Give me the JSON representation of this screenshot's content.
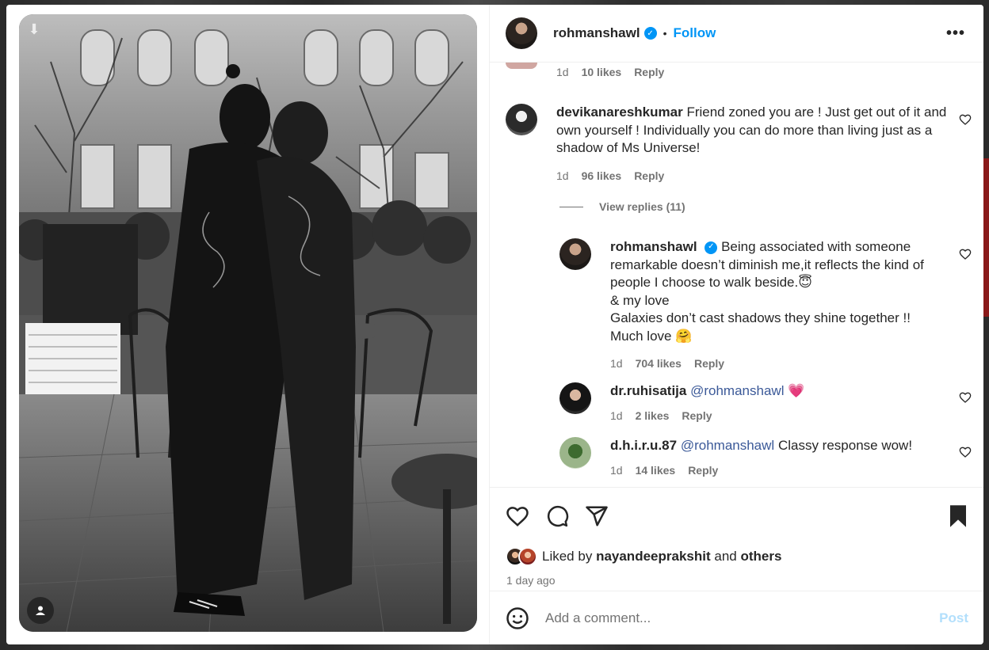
{
  "header": {
    "username": "rohmanshawl",
    "dot": "•",
    "follow_label": "Follow",
    "more_label": "•••"
  },
  "partial_comment": {
    "time": "1d",
    "likes": "10 likes",
    "reply": "Reply"
  },
  "comments": [
    {
      "username": "devikanareshkumar",
      "text": "Friend zoned you are ! Just get out of it and own yourself ! Individually you can do more than living just as a shadow of Ms Universe!",
      "time": "1d",
      "likes": "96 likes",
      "reply": "Reply"
    }
  ],
  "view_replies": "View replies (11)",
  "replies": [
    {
      "username": "rohmanshawl",
      "verified": true,
      "line1": "Being associated with someone remarkable doesn’t diminish me,it reflects the kind of people I choose to walk beside.😇",
      "line2": "& my love",
      "line3": "Galaxies don’t cast shadows they shine together !!",
      "line4": "Much love 🤗",
      "time": "1d",
      "likes": "704 likes",
      "reply": "Reply"
    },
    {
      "username": "dr.ruhisatija",
      "mention": "@rohmanshawl",
      "text": "💗",
      "time": "1d",
      "likes": "2 likes",
      "reply": "Reply"
    },
    {
      "username": "d.h.i.r.u.87",
      "mention": "@rohmanshawl",
      "text": "Classy response wow!",
      "time": "1d",
      "likes": "14 likes",
      "reply": "Reply"
    }
  ],
  "actions": {
    "liked_by_prefix": "Liked by",
    "liked_by_user": "nayandeeprakshit",
    "liked_by_and": "and",
    "liked_by_others": "others",
    "time_ago": "1 day ago"
  },
  "add_comment": {
    "placeholder": "Add a comment...",
    "post_label": "Post"
  },
  "colors": {
    "accent": "#0095f6",
    "text": "#262626",
    "secondary": "#737373",
    "heart_emoji": "#e0245e"
  },
  "icons": [
    "download-icon",
    "user-tag-icon",
    "verified-icon",
    "heart-icon",
    "comment-icon",
    "share-icon",
    "bookmark-icon",
    "emoji-icon",
    "more-icon"
  ]
}
